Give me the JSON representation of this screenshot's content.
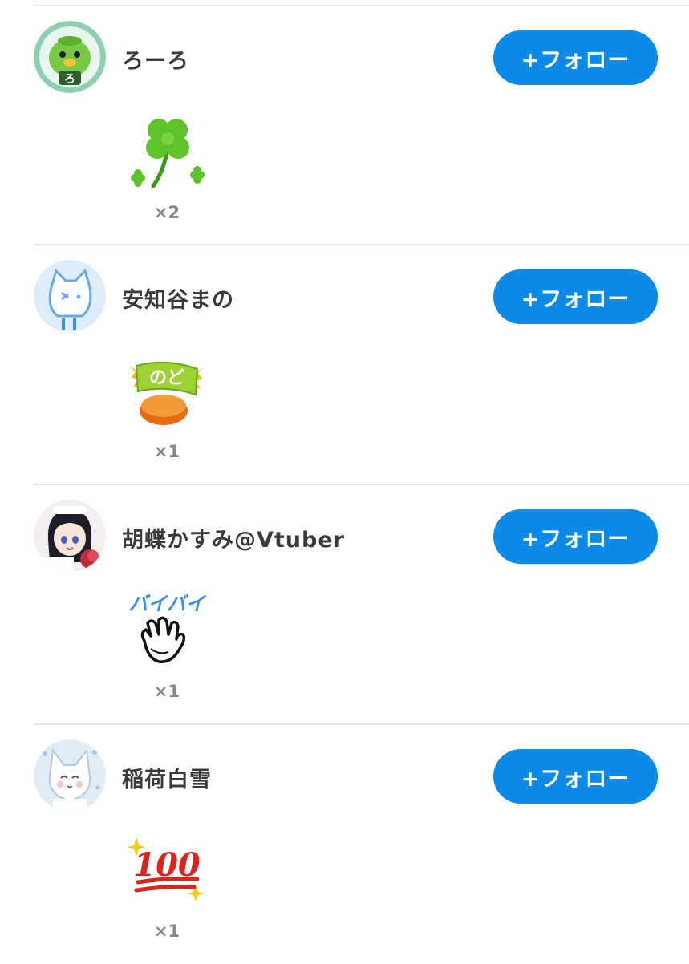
{
  "follow_label": "+フォロー",
  "accent_color": "#0c8ae8",
  "entries": [
    {
      "name": "ろーろ",
      "stamp": "four-leaf-clover-icon",
      "count": "×2"
    },
    {
      "name": "安知谷まの",
      "stamp": "throat-candy-icon",
      "stamp_text": "のど",
      "count": "×1"
    },
    {
      "name": "胡蝶かすみ@Vtuber",
      "stamp": "waving-hand-icon",
      "stamp_text": "バイバイ",
      "count": "×1"
    },
    {
      "name": "稲荷白雪",
      "stamp": "hundred-points-icon",
      "stamp_text": "100",
      "count": "×1"
    }
  ]
}
